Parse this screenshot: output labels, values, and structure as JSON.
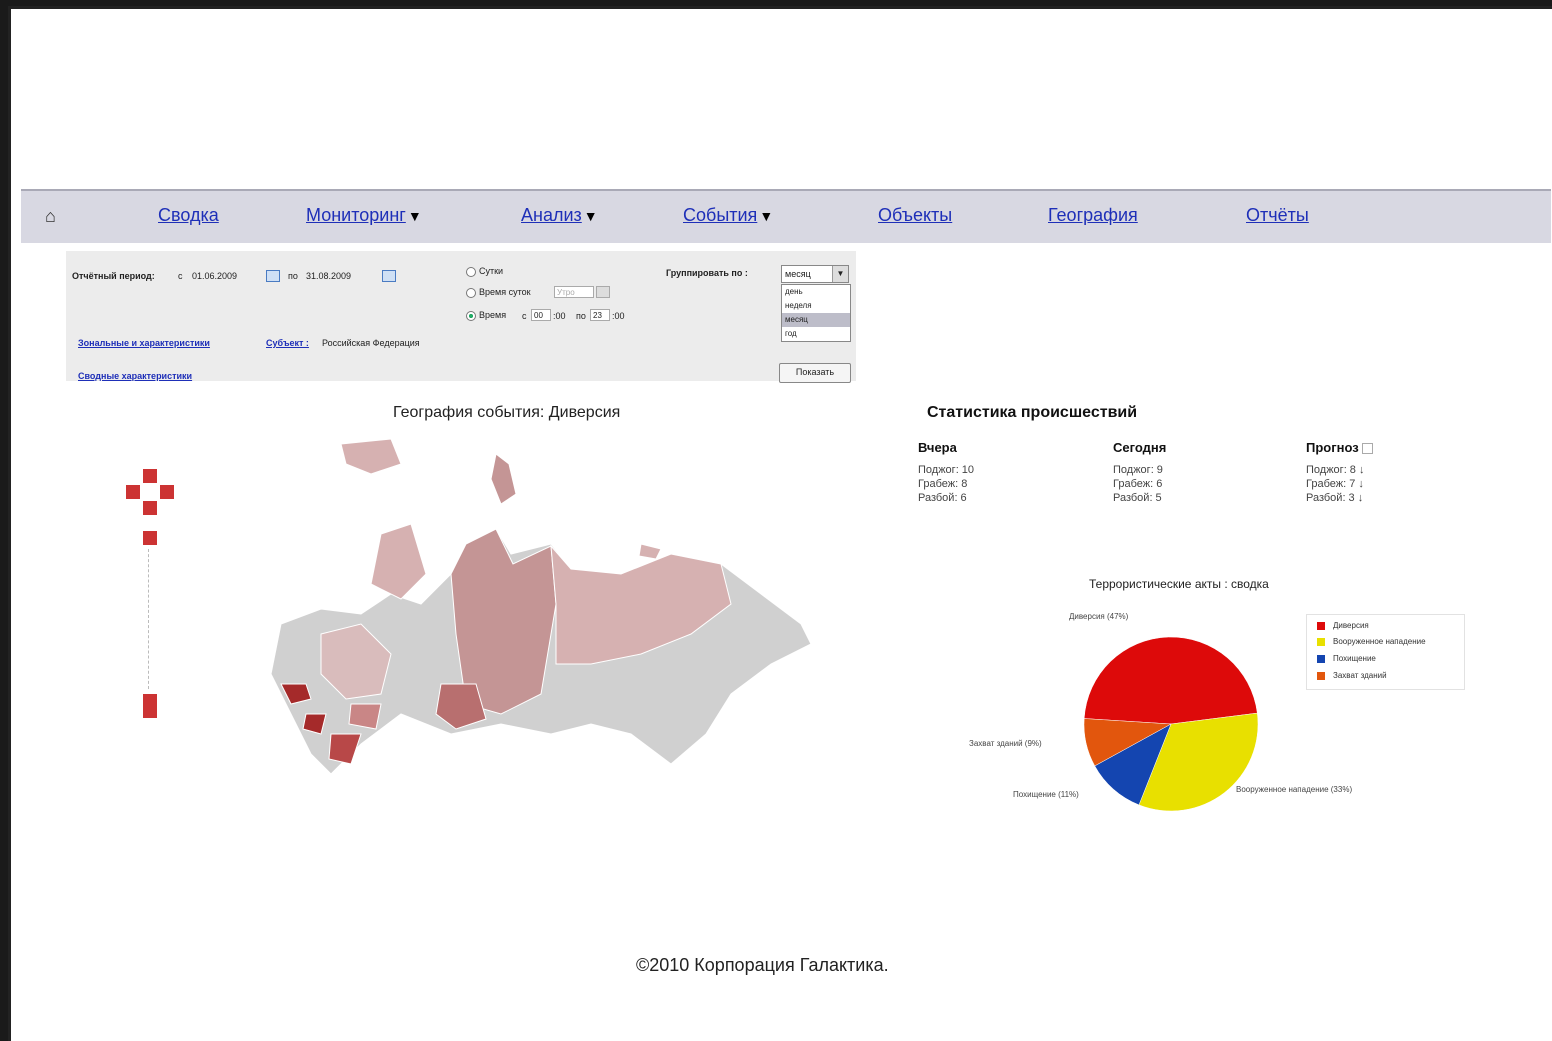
{
  "nav": {
    "home_icon": "home-icon",
    "items": [
      {
        "label": "Сводка",
        "dropdown": false
      },
      {
        "label": "Мониторинг",
        "dropdown": true
      },
      {
        "label": "Анализ",
        "dropdown": true
      },
      {
        "label": "События",
        "dropdown": true
      },
      {
        "label": "Объекты",
        "dropdown": false
      },
      {
        "label": "География",
        "dropdown": false
      },
      {
        "label": "Отчёты",
        "dropdown": false
      }
    ],
    "caret": "▼"
  },
  "filter": {
    "period_label": "Отчётный период:",
    "from_label": "с",
    "from_date": "01.06.2009",
    "to_label": "по",
    "to_date": "31.08.2009",
    "radio_day": "Сутки",
    "radio_time_of_day": "Время суток",
    "time_of_day_value": "Утро",
    "radio_time": "Время",
    "time_from_label": "с",
    "time_from_h": "00",
    "time_from_m": ":00",
    "time_to_label": "по",
    "time_to_h": "23",
    "time_to_m": ":00",
    "group_label": "Группировать по :",
    "group_selected": "месяц",
    "group_options": [
      "день",
      "неделя",
      "месяц",
      "год"
    ],
    "link_features": "Зональные и характеристики",
    "subject_link": "Субъект :",
    "subject_value": "Российская Федерация",
    "link_summary": "Сводные характеристики",
    "show_button": "Показать"
  },
  "map": {
    "title": "География события: Диверсия",
    "accent": "#c0392b"
  },
  "stats": {
    "title": "Статистика происшествий",
    "cards": [
      {
        "title": "Вчера",
        "rows": [
          "Поджог: 10",
          "Грабеж: 8",
          "Разбой: 6"
        ],
        "bg": "#eeeef5"
      },
      {
        "title": "Сегодня",
        "rows": [
          "Поджог: 9",
          "Грабеж: 6",
          "Разбой: 5"
        ],
        "bg": "#e9eefa"
      },
      {
        "title": "Прогноз",
        "rows": [
          "Поджог: 8 ↓",
          "Грабеж: 7 ↓",
          "Разбой: 3 ↓"
        ],
        "bg": "#fbf6d8"
      }
    ]
  },
  "chart_data": {
    "type": "pie",
    "title": "Террористические акты : сводка",
    "series": [
      {
        "name": "Диверсия",
        "value": 47,
        "color": "#dd0a0a",
        "label": "Диверсия (47%)"
      },
      {
        "name": "Вооруженное нападение",
        "value": 33,
        "color": "#e8e000",
        "label": "Вооруженное нападение (33%)"
      },
      {
        "name": "Похищение",
        "value": 11,
        "color": "#1445b0",
        "label": "Похищение (11%)"
      },
      {
        "name": "Захват зданий",
        "value": 9,
        "color": "#e2560d",
        "label": "Захват зданий (9%)"
      }
    ],
    "legend_position": "right"
  },
  "footer": {
    "text": "©2010 Корпорация Галактика."
  }
}
